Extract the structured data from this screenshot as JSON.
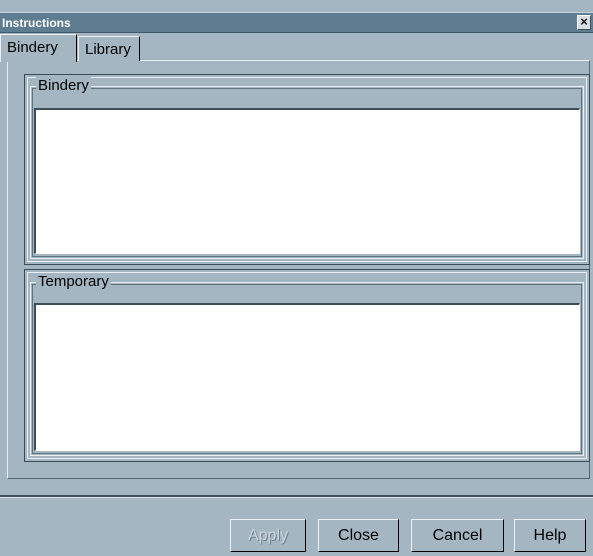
{
  "window": {
    "title": "Instructions",
    "close_glyph": "×"
  },
  "tabs": [
    {
      "label": "Bindery",
      "active": true
    },
    {
      "label": "Library",
      "active": false
    }
  ],
  "groups": {
    "bindery": {
      "label": "Bindery",
      "value": ""
    },
    "temporary": {
      "label": "Temporary",
      "value": ""
    }
  },
  "buttons": {
    "apply": {
      "label": "Apply",
      "enabled": false
    },
    "close": {
      "label": "Close",
      "enabled": true
    },
    "cancel": {
      "label": "Cancel",
      "enabled": true
    },
    "help": {
      "label": "Help",
      "enabled": true
    }
  },
  "colors": {
    "dialog_background": "#a4b6c1",
    "titlebar_background": "#5f7d91",
    "field_background": "#ffffff"
  }
}
